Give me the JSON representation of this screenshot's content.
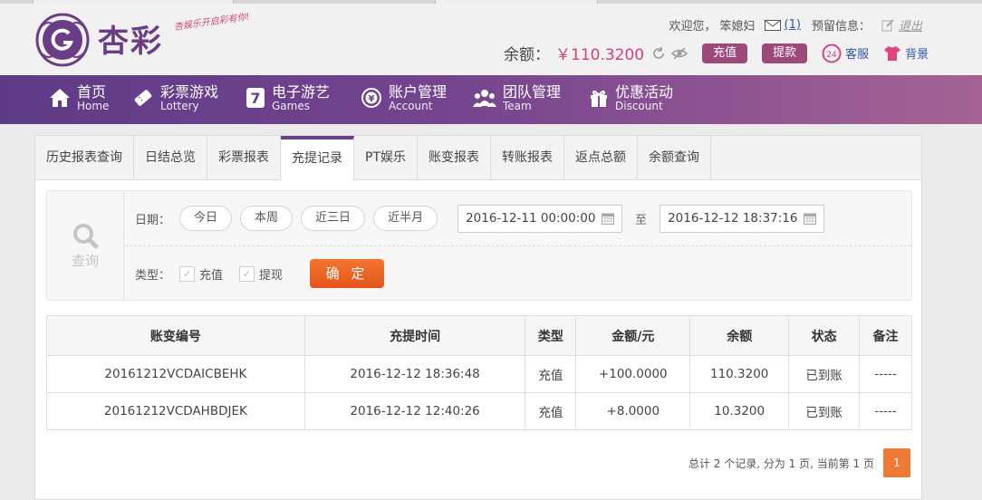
{
  "header": {
    "logo_text": "杏彩",
    "slogan": "杏娱乐开启彩有你!",
    "welcome": "欢迎您，",
    "username": "笨媳妇",
    "message_count": "(1)",
    "reserve_label": "预留信息：",
    "logout": "退出",
    "balance_label": "余额：",
    "balance_value": "￥110.3200",
    "deposit_button": "充值",
    "withdraw_button": "提款",
    "service_label": "客服",
    "background_label": "背景"
  },
  "nav": [
    {
      "zh": "首页",
      "en": "Home",
      "icon": "home-icon"
    },
    {
      "zh": "彩票游戏",
      "en": "Lottery",
      "icon": "ticket-icon"
    },
    {
      "zh": "电子游艺",
      "en": "Games",
      "icon": "slot-seven-icon"
    },
    {
      "zh": "账户管理",
      "en": "Account",
      "icon": "yen-coin-icon"
    },
    {
      "zh": "团队管理",
      "en": "Team",
      "icon": "team-icon"
    },
    {
      "zh": "优惠活动",
      "en": "Discount",
      "icon": "gift-icon"
    }
  ],
  "tabs": [
    "历史报表查询",
    "日结总览",
    "彩票报表",
    "充提记录",
    "PT娱乐",
    "账变报表",
    "转账报表",
    "返点总额",
    "余额查询"
  ],
  "active_tab": "充提记录",
  "filter": {
    "query_label": "查询",
    "date_label": "日期：",
    "quick_ranges": [
      "今日",
      "本周",
      "近三日",
      "近半月"
    ],
    "date_from": "2016-12-11 00:00:00",
    "to_label": "至",
    "date_to": "2016-12-12 18:37:16",
    "type_label": "类型：",
    "types": [
      "充值",
      "提现"
    ],
    "confirm_button": "确 定"
  },
  "table": {
    "headers": [
      "账变编号",
      "充提时间",
      "类型",
      "金额/元",
      "余额",
      "状态",
      "备注"
    ],
    "rows": [
      [
        "20161212VCDAICBEHK",
        "2016-12-12 18:36:48",
        "充值",
        "+100.0000",
        "110.3200",
        "已到账",
        "-----"
      ],
      [
        "20161212VCDAHBDJEK",
        "2016-12-12 12:40:26",
        "充值",
        "+8.0000",
        "10.3200",
        "已到账",
        "-----"
      ]
    ]
  },
  "pagination": {
    "summary": "总计 2 个记录, 分为 1 页, 当前第 1 页",
    "current_page": "1"
  },
  "colors": {
    "nav_start": "#5f3b86",
    "nav_end": "#a56394",
    "accent_button": "#9c4a7a",
    "confirm": "#e4551a",
    "amount": "#d3245e",
    "status_ok": "#2f9a2f"
  }
}
